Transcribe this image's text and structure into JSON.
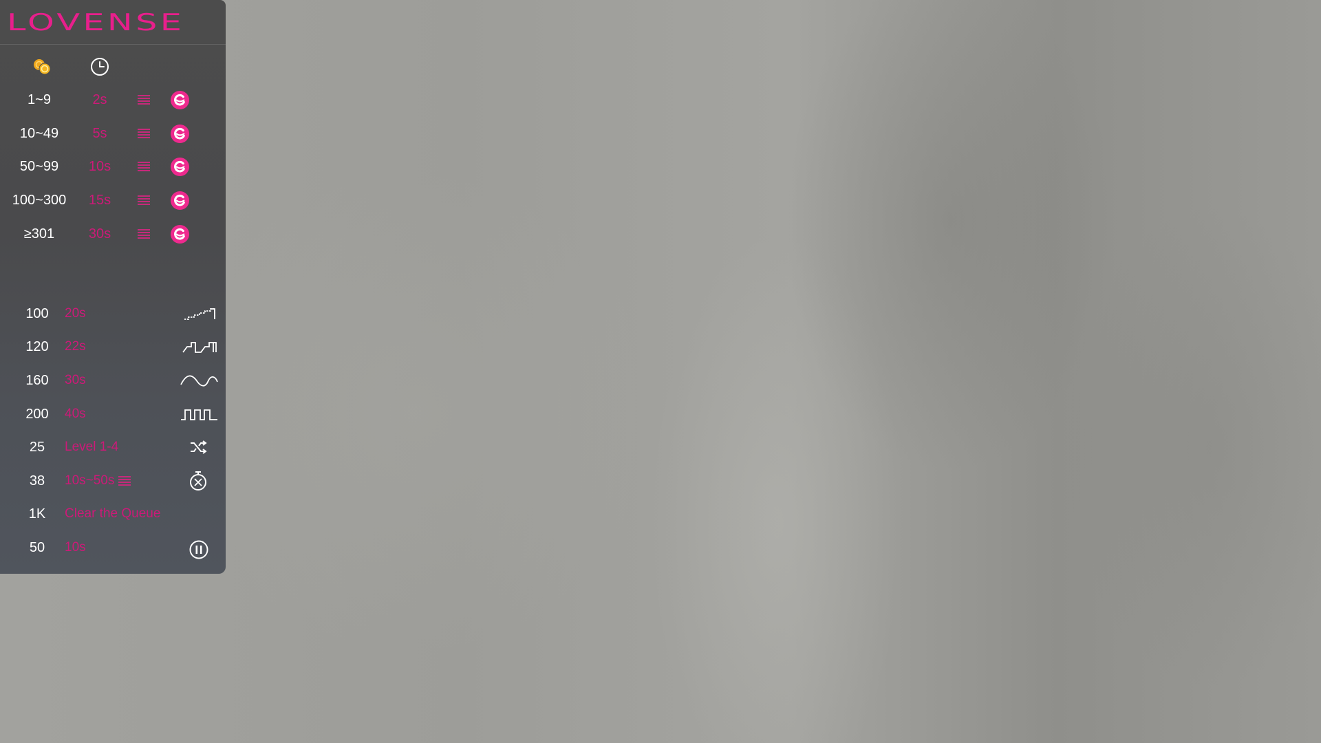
{
  "brand": {
    "logo_text": "LOVENSE",
    "accent_color": "#e81f8c",
    "duration_color": "#cc1a78"
  },
  "header": {
    "icons": [
      "coins-icon",
      "clock-icon"
    ]
  },
  "tip_levels": [
    {
      "range": "1~9",
      "duration": "2s",
      "icon": "lovense-vibe-icon"
    },
    {
      "range": "10~49",
      "duration": "5s",
      "icon": "lovense-vibe-icon"
    },
    {
      "range": "50~99",
      "duration": "10s",
      "icon": "lovense-vibe-icon"
    },
    {
      "range": "100~300",
      "duration": "15s",
      "icon": "lovense-vibe-icon"
    },
    {
      "range": "≥301",
      "duration": "30s",
      "icon": "lovense-vibe-icon"
    }
  ],
  "special_commands": [
    {
      "amount": "100",
      "action": "20s",
      "icon": "pattern-step-up-icon"
    },
    {
      "amount": "120",
      "action": "22s",
      "icon": "pattern-pulse-icon"
    },
    {
      "amount": "160",
      "action": "30s",
      "icon": "pattern-wave-icon"
    },
    {
      "amount": "200",
      "action": "40s",
      "icon": "pattern-square-icon"
    },
    {
      "amount": "25",
      "action": "Level 1-4",
      "icon": "random-shuffle-icon"
    },
    {
      "amount": "38",
      "action": "10s~50s",
      "icon": "random-time-icon"
    },
    {
      "amount": "1K",
      "action": "Clear the Queue",
      "icon": ""
    },
    {
      "amount": "50",
      "action": "10s",
      "icon": "pause-icon"
    }
  ]
}
